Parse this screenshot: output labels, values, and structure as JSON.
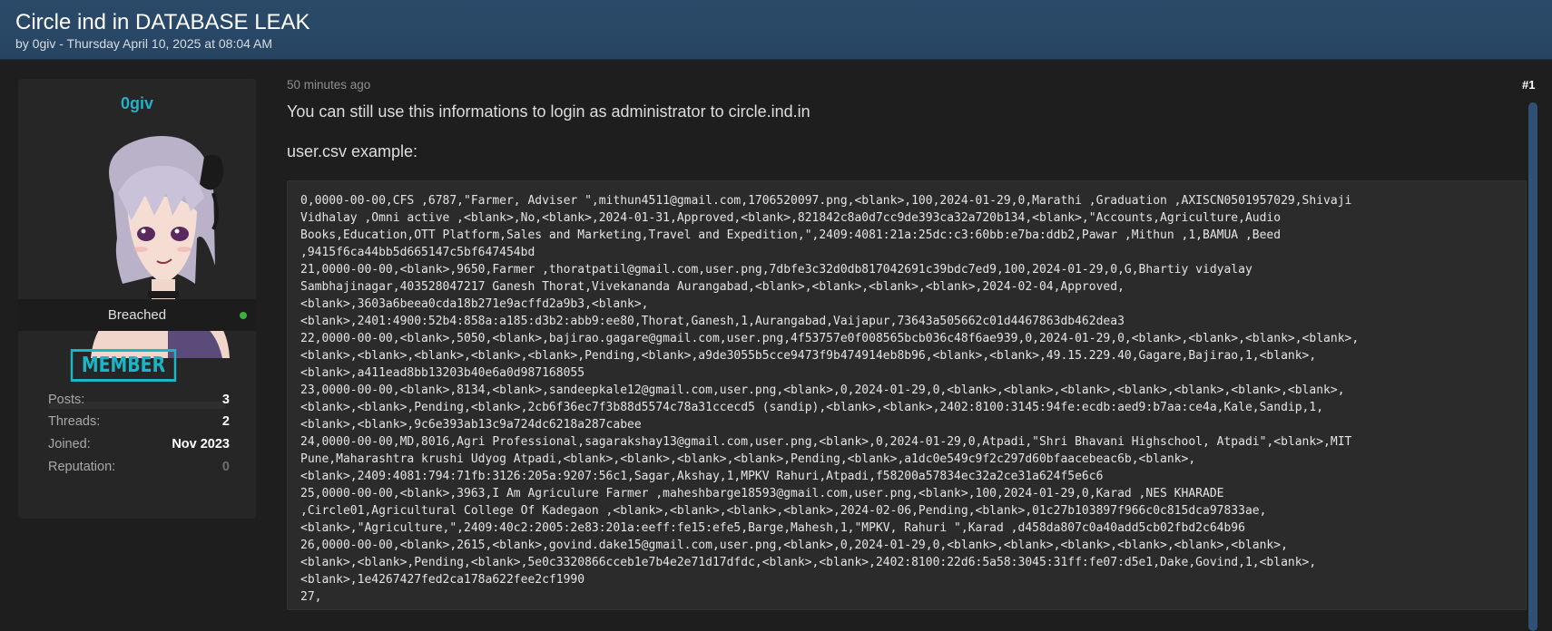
{
  "thread": {
    "title": "Circle ind in DATABASE LEAK",
    "byline": "by 0giv - Thursday April 10, 2025 at 08:04 AM"
  },
  "author": {
    "username": "0giv",
    "status": "Breached",
    "rank": "MEMBER",
    "stats": [
      {
        "label": "Posts:",
        "value": "3"
      },
      {
        "label": "Threads:",
        "value": "2"
      },
      {
        "label": "Joined:",
        "value": "Nov 2023"
      },
      {
        "label": "Reputation:",
        "value": "0"
      }
    ]
  },
  "post": {
    "time": "50 minutes ago",
    "number": "#1",
    "text1": "You can still use this informations to login as administrator to circle.ind.in",
    "text2": "user.csv example:",
    "code_lines": [
      "0,0000-00-00,CFS ,6787,\"Farmer, Adviser \",mithun4511@gmail.com,1706520097.png,<blank>,100,2024-01-29,0,Marathi ,Graduation ,AXISCN0501957029,Shivaji",
      "Vidhalay ,Omni active ,<blank>,No,<blank>,2024-01-31,Approved,<blank>,821842c8a0d7cc9de393ca32a720b134,<blank>,\"Accounts,Agriculture,Audio",
      "Books,Education,OTT Platform,Sales and Marketing,Travel and Expedition,\",2409:4081:21a:25dc:c3:60bb:e7ba:ddb2,Pawar ,Mithun ,1,BAMUA ,Beed",
      ",9415f6ca44bb5d665147c5bf647454bd",
      "21,0000-00-00,<blank>,9650,Farmer ,thoratpatil@gmail.com,user.png,7dbfe3c32d0db817042691c39bdc7ed9,100,2024-01-29,0,G,Bhartiy vidyalay",
      "Sambhajinagar,403528047217 Ganesh Thorat,Vivekananda Aurangabad,<blank>,<blank>,<blank>,<blank>,2024-02-04,Approved,",
      "<blank>,3603a6beea0cda18b271e9acffd2a9b3,<blank>,",
      "<blank>,2401:4900:52b4:858a:a185:d3b2:abb9:ee80,Thorat,Ganesh,1,Aurangabad,Vaijapur,73643a505662c01d4467863db462dea3",
      "22,0000-00-00,<blank>,5050,<blank>,bajirao.gagare@gmail.com,user.png,4f53757e0f008565bcb036c48f6ae939,0,2024-01-29,0,<blank>,<blank>,<blank>,<blank>,",
      "<blank>,<blank>,<blank>,<blank>,<blank>,Pending,<blank>,a9de3055b5cce9473f9b474914eb8b96,<blank>,<blank>,49.15.229.40,Gagare,Bajirao,1,<blank>,",
      "<blank>,a411ead8bb13203b40e6a0d987168055",
      "23,0000-00-00,<blank>,8134,<blank>,sandeepkale12@gmail.com,user.png,<blank>,0,2024-01-29,0,<blank>,<blank>,<blank>,<blank>,<blank>,<blank>,<blank>,",
      "<blank>,<blank>,Pending,<blank>,2cb6f36ec7f3b88d5574c78a31ccecd5 (sandip),<blank>,<blank>,2402:8100:3145:94fe:ecdb:aed9:b7aa:ce4a,Kale,Sandip,1,",
      "<blank>,<blank>,9c6e393ab13c9a724dc6218a287cabee",
      "24,0000-00-00,MD,8016,Agri Professional,sagarakshay13@gmail.com,user.png,<blank>,0,2024-01-29,0,Atpadi,\"Shri Bhavani Highschool, Atpadi\",<blank>,MIT",
      "Pune,Maharashtra krushi Udyog Atpadi,<blank>,<blank>,<blank>,<blank>,Pending,<blank>,a1dc0e549c9f2c297d60bfaacebeac6b,<blank>,",
      "<blank>,2409:4081:794:71fb:3126:205a:9207:56c1,Sagar,Akshay,1,MPKV Rahuri,Atpadi,f58200a57834ec32a2ce31a624f5e6c6",
      "25,0000-00-00,<blank>,3963,I Am Agriculure Farmer ,maheshbarge18593@gmail.com,user.png,<blank>,100,2024-01-29,0,Karad ,NES KHARADE",
      ",Circle01,Agricultural College Of Kadegaon ,<blank>,<blank>,<blank>,<blank>,2024-02-06,Pending,<blank>,01c27b103897f966c0c815dca97833ae,",
      "<blank>,\"Agriculture,\",2409:40c2:2005:2e83:201a:eeff:fe15:efe5,Barge,Mahesh,1,\"MPKV, Rahuri \",Karad ,d458da807c0a40add5cb02fbd2c64b96",
      "26,0000-00-00,<blank>,2615,<blank>,govind.dake15@gmail.com,user.png,<blank>,0,2024-01-29,0,<blank>,<blank>,<blank>,<blank>,<blank>,<blank>,",
      "<blank>,<blank>,Pending,<blank>,5e0c3320866cceb1e7b4e2e71d17dfdc,<blank>,<blank>,2402:8100:22d6:5a58:3045:31ff:fe07:d5e1,Dake,Govind,1,<blank>,",
      "<blank>,1e4267427fed2ca178a622fee2cf1990",
      "27,"
    ]
  },
  "colors": {
    "header_bg": "#2b4a69",
    "accent_cyan": "#1fb2c9",
    "online_green": "#3cb043",
    "scroll_thumb": "#2f5175"
  }
}
